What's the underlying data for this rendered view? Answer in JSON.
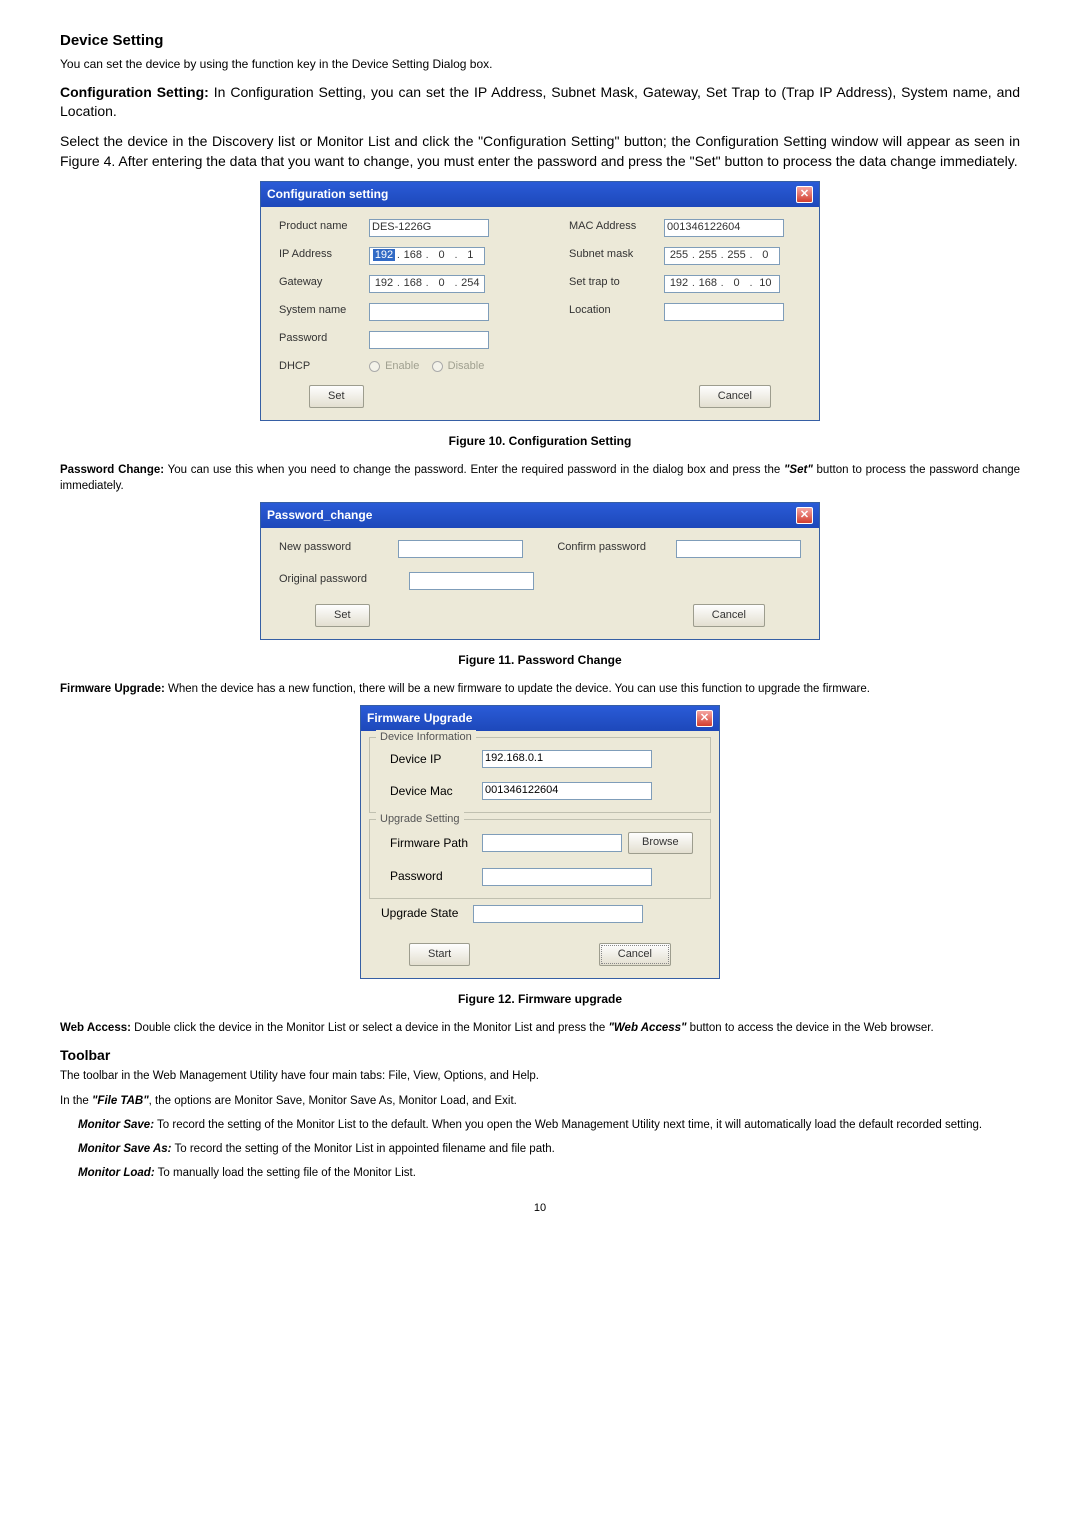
{
  "headings": {
    "device_setting": "Device Setting",
    "toolbar": "Toolbar"
  },
  "paragraphs": {
    "device_setting_intro": "You can set the device by using the function key in the Device Setting Dialog box.",
    "config_setting_label": "Configuration Setting:",
    "config_setting_text": " In Configuration Setting, you can set the IP Address, Subnet Mask, Gateway, Set Trap to (Trap IP Address), System name, and Location.",
    "config_select_text": "Select the device in the Discovery list or Monitor List and click the \"Configuration Setting\" button; the Configuration Setting window will appear as seen in Figure 4. After entering the data that you want to change, you must enter the password and press the \"Set\" button to process the data change immediately.",
    "figure10": "Figure 10. Configuration Setting",
    "password_change_label": "Password Change:",
    "password_change_text1": " You can use this when you need to change the password. Enter the required password in the dialog box and press the ",
    "password_change_set": "\"Set\"",
    "password_change_text2": " button to process the password change immediately.",
    "figure11": "Figure 11. Password Change",
    "firmware_upgrade_label": "Firmware Upgrade:",
    "firmware_upgrade_text": " When the device has a new function, there will be a new firmware to update the device. You can use this function to upgrade the firmware.",
    "figure12": "Figure 12. Firmware upgrade",
    "web_access_label": "Web Access:",
    "web_access_text1": " Double click the device in the Monitor List or select a device in the Monitor List and press the ",
    "web_access_italic": "\"Web Access\"",
    "web_access_text2": " button to access the device in the Web browser.",
    "toolbar_intro": "The toolbar in the Web Management Utility have four main tabs: File, View, Options, and Help.",
    "file_tab_text1": "In the ",
    "file_tab_italic": "\"File TAB\"",
    "file_tab_text2": ", the options are Monitor Save, Monitor Save As, Monitor Load, and Exit.",
    "monitor_save_label": "Monitor Save:",
    "monitor_save_text": " To record the setting of the Monitor List to the default. When you open the Web Management Utility next time, it will automatically load the default recorded setting.",
    "monitor_save_as_label": "Monitor Save As:",
    "monitor_save_as_text": " To record the setting of the Monitor List in appointed filename and file path.",
    "monitor_load_label": "Monitor Load:",
    "monitor_load_text": " To manually load the setting file of the Monitor List."
  },
  "config_dialog": {
    "title": "Configuration setting",
    "labels": {
      "product_name": "Product name",
      "ip_address": "IP Address",
      "gateway": "Gateway",
      "system_name": "System name",
      "password": "Password",
      "dhcp": "DHCP",
      "mac_address": "MAC Address",
      "subnet_mask": "Subnet mask",
      "set_trap_to": "Set trap to",
      "location": "Location",
      "enable": "Enable",
      "disable": "Disable"
    },
    "values": {
      "product_name": "DES-1226G",
      "mac_address": "001346122604",
      "ip": [
        "192",
        "168",
        "0",
        "1"
      ],
      "subnet": [
        "255",
        "255",
        "255",
        "0"
      ],
      "gateway": [
        "192",
        "168",
        "0",
        "254"
      ],
      "trap": [
        "192",
        "168",
        "0",
        "10"
      ]
    },
    "buttons": {
      "set": "Set",
      "cancel": "Cancel"
    }
  },
  "password_dialog": {
    "title": "Password_change",
    "labels": {
      "new_password": "New password",
      "confirm_password": "Confirm password",
      "original_password": "Original password"
    },
    "buttons": {
      "set": "Set",
      "cancel": "Cancel"
    }
  },
  "firmware_dialog": {
    "title": "Firmware Upgrade",
    "legends": {
      "device_info": "Device Information",
      "upgrade_setting": "Upgrade Setting"
    },
    "labels": {
      "device_ip": "Device IP",
      "device_mac": "Device Mac",
      "firmware_path": "Firmware Path",
      "password": "Password",
      "upgrade_state": "Upgrade State"
    },
    "values": {
      "device_ip": "192.168.0.1",
      "device_mac": "001346122604"
    },
    "buttons": {
      "browse": "Browse",
      "start": "Start",
      "cancel": "Cancel"
    }
  },
  "page_number": "10"
}
